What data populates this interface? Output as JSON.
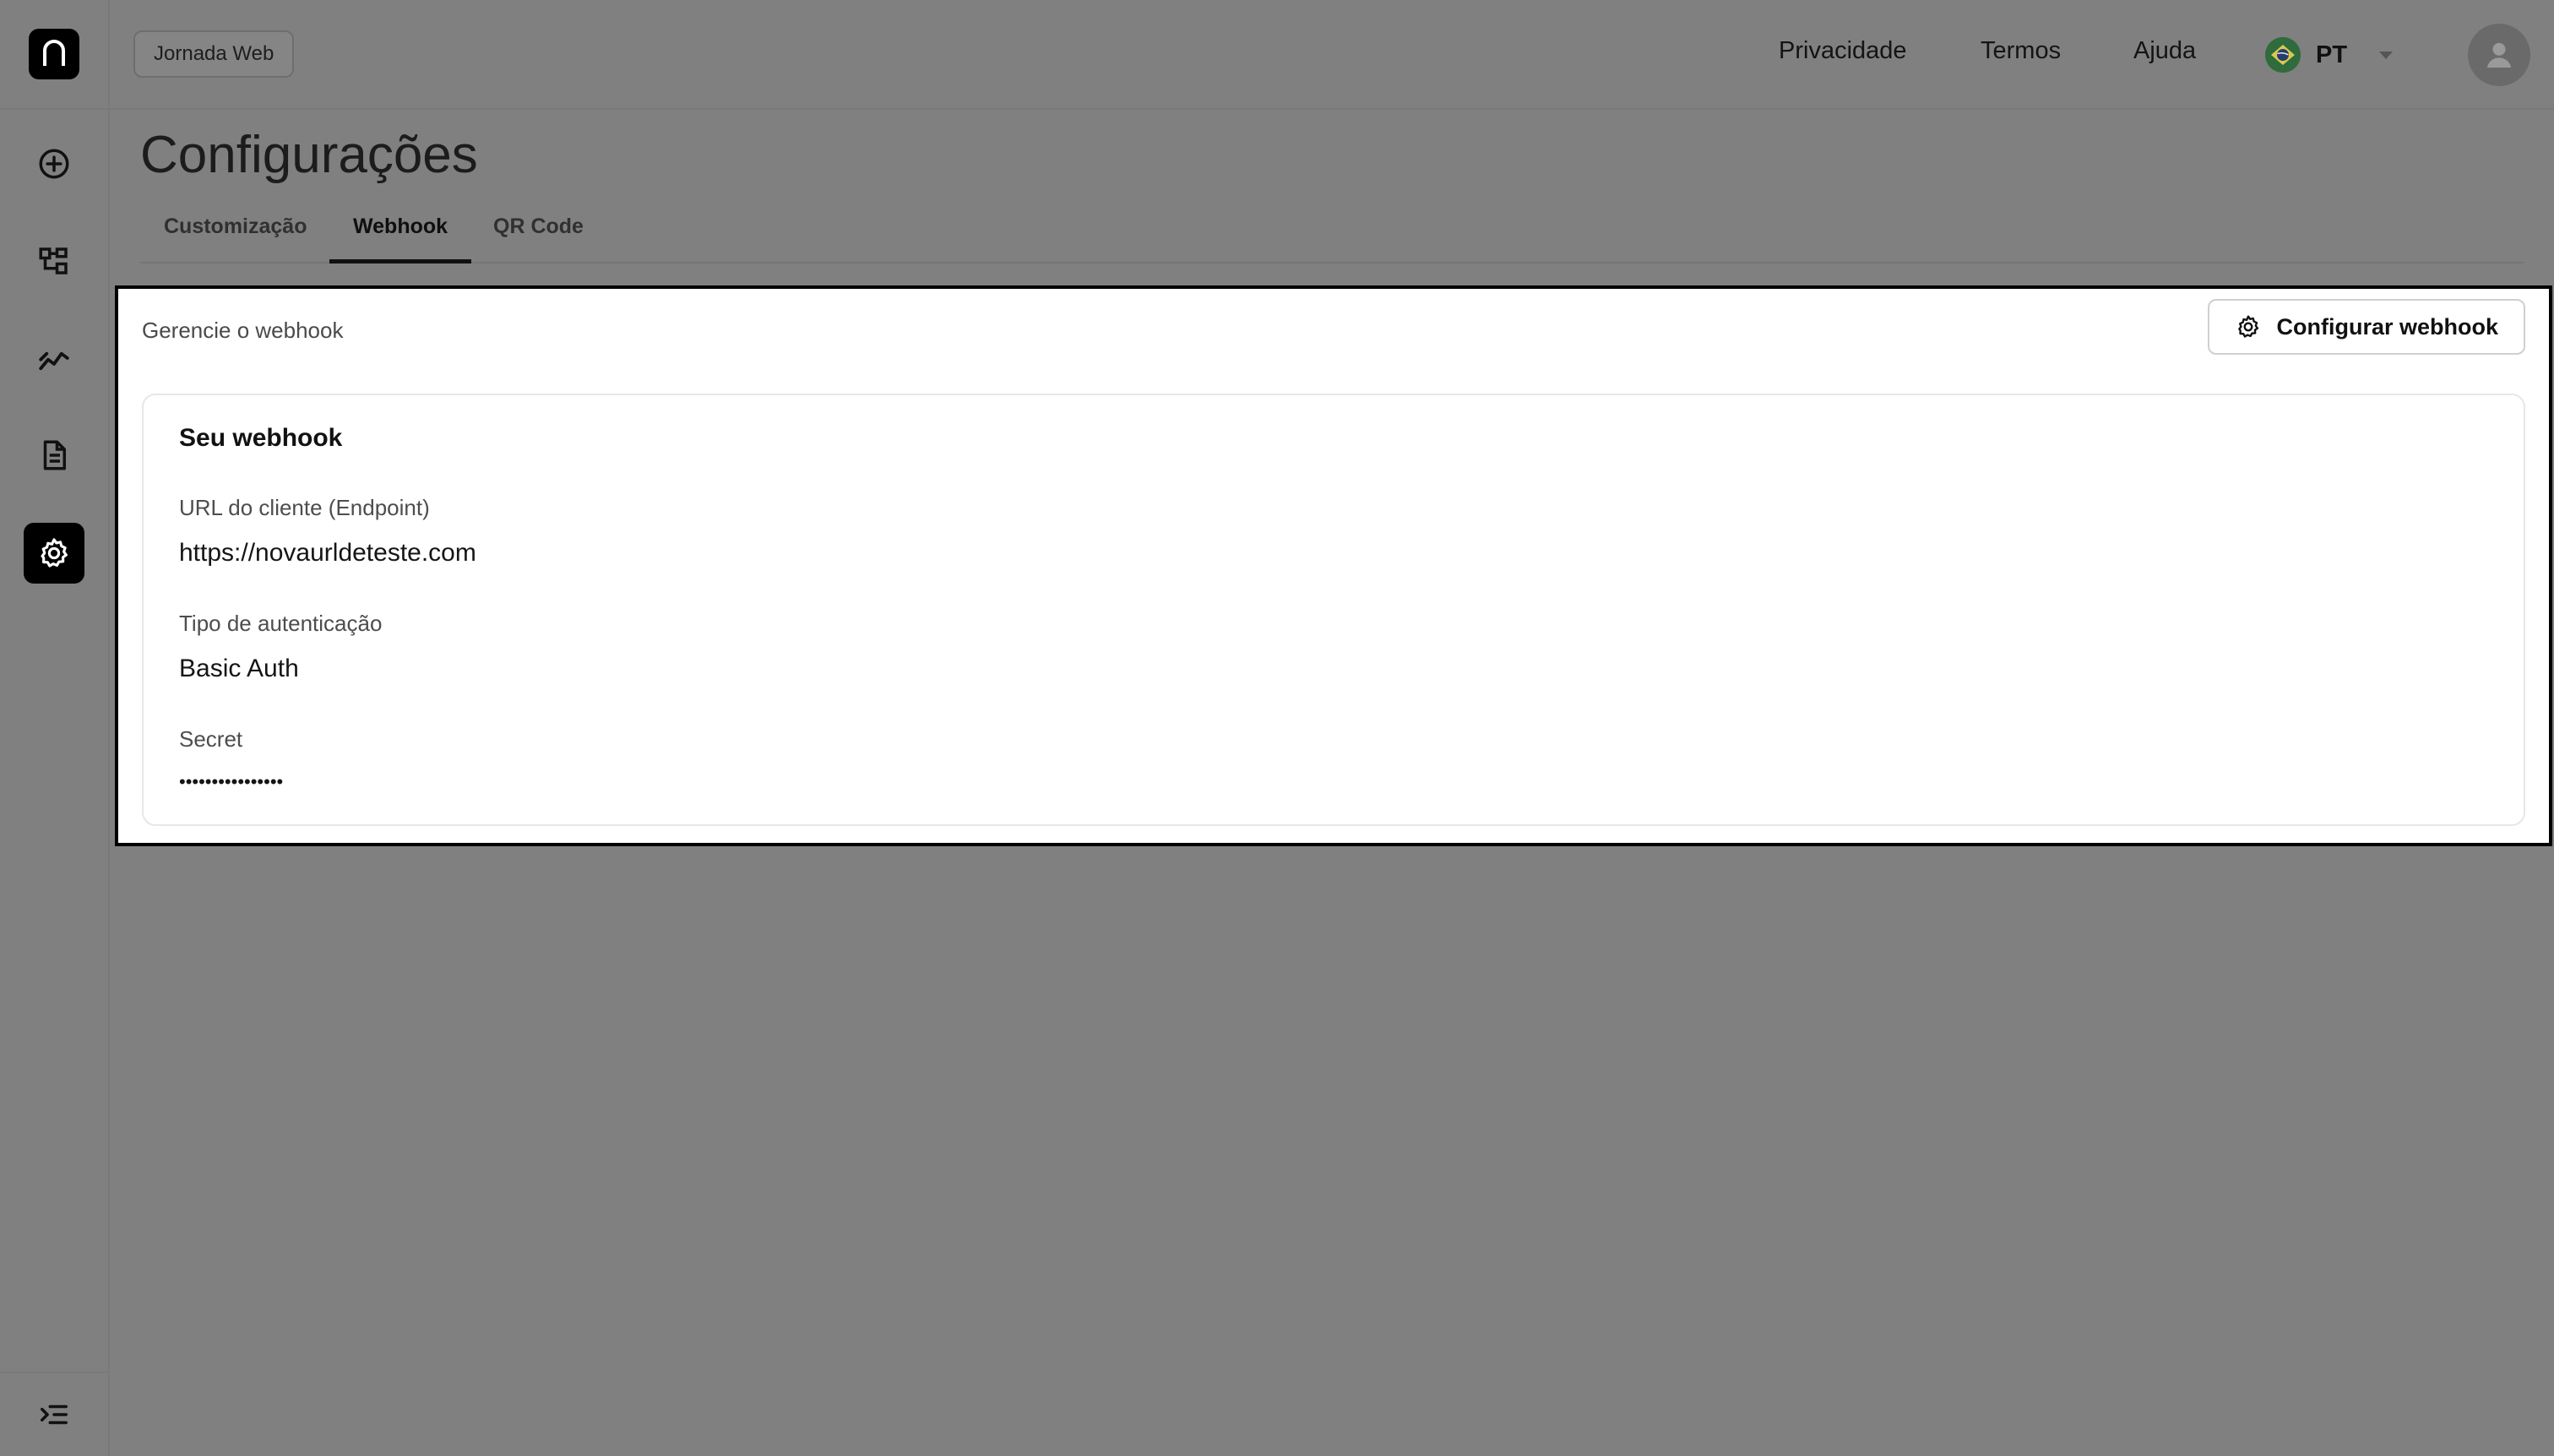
{
  "header": {
    "journey_badge": "Jornada Web",
    "links": {
      "privacy": "Privacidade",
      "terms": "Termos",
      "help": "Ajuda"
    },
    "language": {
      "code": "PT",
      "flag_icon": "brazil-flag-icon"
    }
  },
  "sidebar": {
    "items": [
      {
        "name": "create",
        "icon": "plus-circle-icon"
      },
      {
        "name": "flows",
        "icon": "flow-diagram-icon"
      },
      {
        "name": "analytics",
        "icon": "trend-chart-icon"
      },
      {
        "name": "documents",
        "icon": "document-icon"
      },
      {
        "name": "settings",
        "icon": "gear-icon",
        "active": true
      }
    ],
    "collapse_icon": "collapse-menu-icon"
  },
  "page": {
    "title": "Configurações",
    "tabs": [
      {
        "label": "Customização",
        "active": false
      },
      {
        "label": "Webhook",
        "active": true
      },
      {
        "label": "QR Code",
        "active": false
      }
    ]
  },
  "webhook": {
    "subtitle": "Gerencie o webhook",
    "configure_button": "Configurar webhook",
    "card_title": "Seu webhook",
    "fields": [
      {
        "label": "URL do cliente (Endpoint)",
        "value": "https://novaurldeteste.com"
      },
      {
        "label": "Tipo de autenticação",
        "value": "Basic Auth"
      },
      {
        "label": "Secret",
        "value": "••••••••••••••••"
      }
    ]
  },
  "colors": {
    "overlay": "#808080",
    "accent": "#000000",
    "panel": "#ffffff"
  }
}
